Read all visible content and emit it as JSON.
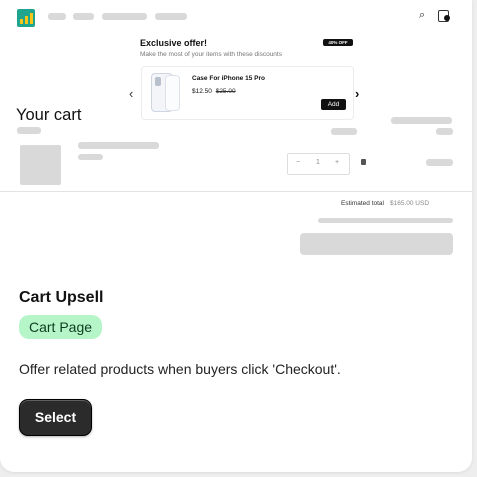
{
  "popup": {
    "title": "Exclusive offer!",
    "subtitle": "Make the most of your items with these discounts",
    "tag": "40% OFF",
    "product_name": "Case For iPhone 15 Pro",
    "price": "$12.50",
    "compare_price": "$25.00",
    "add_label": "Add",
    "prev_arrow": "‹",
    "next_arrow": "›"
  },
  "cart": {
    "title": "Your cart",
    "qty_minus": "−",
    "qty_value": "1",
    "qty_plus": "+",
    "estimated_label": "Estimated total",
    "estimated_value": "$165.00 USD"
  },
  "header": {
    "search_icon": "⌕",
    "bag_icon": "👜"
  },
  "info": {
    "title": "Cart Upsell",
    "badge": "Cart Page",
    "description": "Offer related products when buyers click 'Checkout'.",
    "select_label": "Select"
  },
  "colors": {
    "logo_bg": "#1fa58e",
    "badge_bg": "#b6f5c8",
    "button_bg": "#2b2b2b"
  }
}
